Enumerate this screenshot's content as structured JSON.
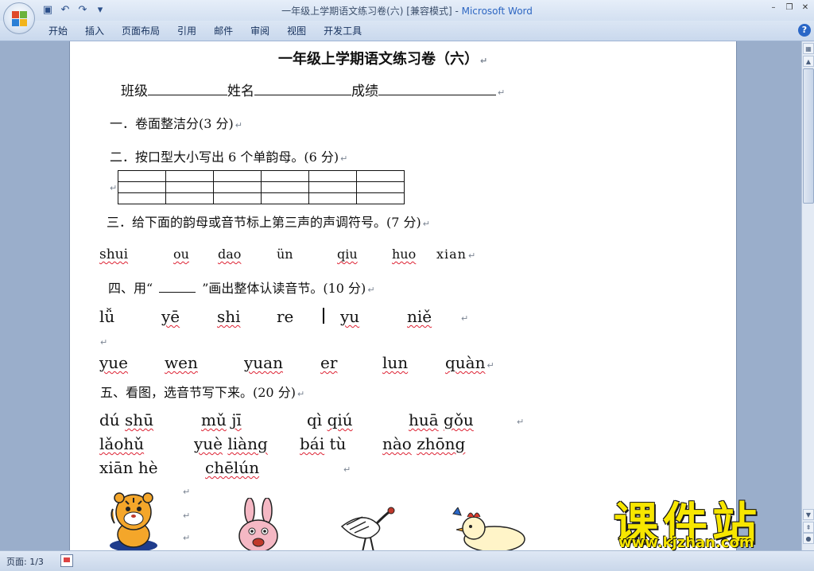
{
  "window": {
    "title": "一年级上学期语文练习卷(六) [兼容模式] - ",
    "app_name": "Microsoft Word"
  },
  "quick_access": {
    "icons": [
      "save-icon",
      "undo-icon",
      "redo-icon",
      "customize-icon"
    ]
  },
  "ribbon": {
    "tabs": [
      "开始",
      "插入",
      "页面布局",
      "引用",
      "邮件",
      "审阅",
      "视图",
      "开发工具"
    ]
  },
  "document": {
    "title": "一年级上学期语文练习卷（六）",
    "info_line": {
      "class_label": "班级",
      "name_label": "姓名",
      "score_label": "成绩"
    },
    "q1": "一．卷面整洁分(3 分)",
    "q2": "二．按口型大小写出 6 个单韵母。(6 分)",
    "q3": "三．给下面的韵母或音节标上第三声的声调符号。(7 分)",
    "q3_items": [
      "shui",
      "ou",
      "dao",
      "ün",
      "qiu",
      "huo",
      "xian"
    ],
    "q4_prefix": "四、用“",
    "q4_suffix": "”画出整体认读音节。(10 分)",
    "q4_row1": [
      "lǚ",
      "yē",
      "shi",
      "re",
      "yu",
      "niě"
    ],
    "q4_row2": [
      "yue",
      "wen",
      "yuan",
      "er",
      "lun",
      "quàn"
    ],
    "q5": "五、看图，选音节写下来。(20 分)",
    "q5_rows": [
      [
        "dú",
        "shū",
        "mǔ",
        "jī",
        "qì",
        "qiú",
        "huā",
        "gǒu"
      ],
      [
        "lǎohǔ",
        "yuè",
        "liàng",
        "bái",
        "tù",
        "nào",
        "zhōng"
      ],
      [
        "xiān",
        "hè",
        "chēlún"
      ]
    ]
  },
  "watermark": {
    "main": "课件站",
    "url": "www.kjzhan.com"
  },
  "status": {
    "page": "页面: 1/3"
  },
  "colors": {
    "accent": "#2d66c2",
    "watermark": "#f7e600",
    "spellcheck": "#dd2233"
  }
}
